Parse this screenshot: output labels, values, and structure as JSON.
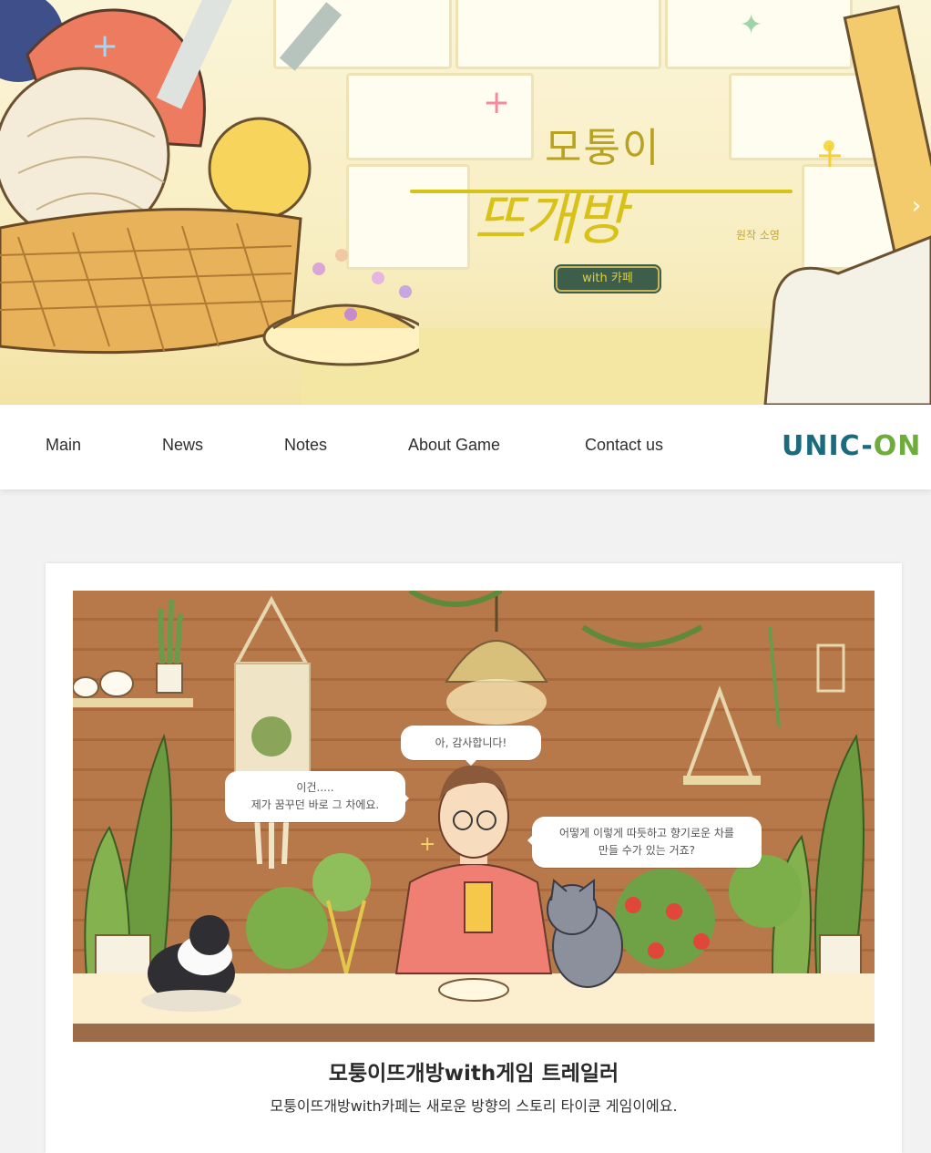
{
  "hero": {
    "title_small": "모퉁이",
    "title_big": "뜨개방",
    "credit": "원작 소영",
    "badge": "with 카페",
    "prev_arrow": "‹",
    "next_arrow": "›"
  },
  "nav": {
    "items": [
      {
        "label": "Main"
      },
      {
        "label": "News"
      },
      {
        "label": "Notes"
      },
      {
        "label": "About Game"
      },
      {
        "label": "Contact us"
      }
    ],
    "brand": {
      "part1": "UNIC",
      "dash": "-",
      "part2": "ON"
    }
  },
  "card": {
    "bubbles": {
      "left": [
        "이건.....",
        "제가 꿈꾸던 바로 그 차에요."
      ],
      "top": "아, 감사합니다!",
      "right": [
        "어떻게 이렇게 따듯하고 향기로운 차를",
        "만들 수가 있는 거죠?"
      ]
    },
    "title": "모퉁이뜨개방with게임 트레일러",
    "description": "모퉁이뜨개방with카페는 새로운 방향의 스토리 타이쿤 게임이에요."
  },
  "colors": {
    "brand_teal": "#1b6b7e",
    "brand_green": "#6eac3c",
    "logo_yellow": "#d8c21a",
    "wood": "#b7794a"
  }
}
